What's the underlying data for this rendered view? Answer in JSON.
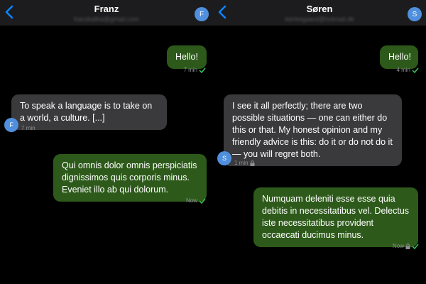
{
  "conversations": [
    {
      "header": {
        "title": "Franz",
        "subtitle": "franzkafka@gmail.com",
        "avatar_initial": "F"
      },
      "messages": [
        {
          "direction": "outgoing",
          "text": "Hello!",
          "time": "7 min",
          "status": "read"
        },
        {
          "direction": "incoming",
          "text": "To speak a language is to take on a world, a culture. [...]",
          "time": "7 min",
          "avatar_initial": "F"
        },
        {
          "direction": "outgoing",
          "text": "Qui omnis dolor omnis perspiciatis dignissimos quis corporis minus. Eveniet illo ab qui dolorum.",
          "time": "Now",
          "status": "read"
        }
      ]
    },
    {
      "header": {
        "title": "Søren",
        "subtitle": "kierkegaard@hotmail.dk",
        "avatar_initial": "S"
      },
      "messages": [
        {
          "direction": "outgoing",
          "text": "Hello!",
          "time": "4 min",
          "status": "read"
        },
        {
          "direction": "incoming",
          "text": "I see it all perfectly; there are two possible situations — one can either do this or that. My honest opinion and my friendly advice is this: do it or do not do it — you will regret both.",
          "time": "1 min",
          "avatar_initial": "S",
          "locked": true
        },
        {
          "direction": "outgoing",
          "text": "Numquam deleniti esse esse quia debitis in necessitatibus vel. Delectus iste necessitatibus provident occaecati ducimus minus.",
          "time": "Now",
          "status": "read",
          "locked": true
        }
      ]
    }
  ],
  "colors": {
    "accent": "#0a84ff",
    "outgoing_bubble": "#2d5a1a",
    "incoming_bubble": "#3a3a3c",
    "read_check": "#34c759",
    "avatar": "#4f8fdd",
    "background": "#000000"
  },
  "icons": {
    "back": "chevron-left-icon",
    "read": "checkmark-icon",
    "secure": "lock-icon"
  }
}
